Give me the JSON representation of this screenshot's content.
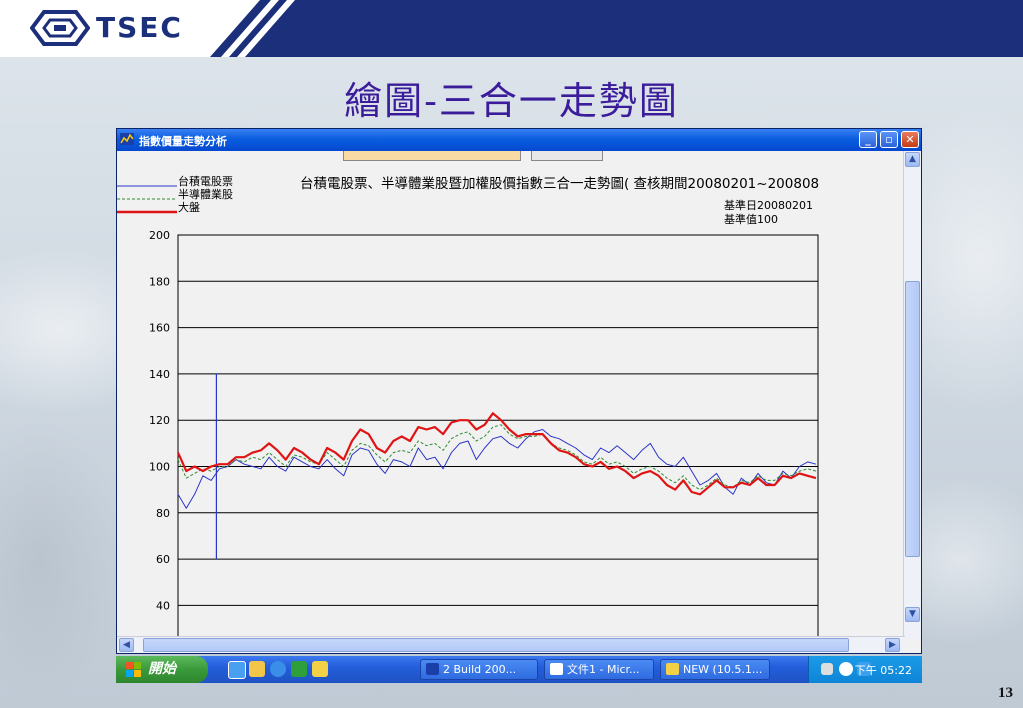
{
  "slide": {
    "logo_text": "TSEC",
    "title": "繪圖-三合一走勢圖",
    "page_number": "13"
  },
  "window": {
    "title": "指數價量走勢分析",
    "buttons": [
      "minimize",
      "restore",
      "close"
    ]
  },
  "chart_data": {
    "type": "line",
    "title": "台積電股票、半導體業股暨加權股價指數三合一走勢圖( 查核期間20080201~200808",
    "base_date_label": "基準日20080201",
    "base_value_label": "基準值100",
    "ylim": [
      30,
      200
    ],
    "yticks": [
      200,
      180,
      160,
      140,
      120,
      100,
      80,
      60,
      40
    ],
    "marker_line": {
      "x": 0.06,
      "y_from": 60,
      "y_to": 140
    },
    "series": [
      {
        "name": "台積電股票",
        "color": "#2a35c9",
        "values": [
          88,
          82,
          88,
          96,
          94,
          99,
          100,
          103,
          101,
          100,
          99,
          104,
          100,
          98,
          104,
          102,
          100,
          99,
          103,
          99,
          96,
          105,
          108,
          107,
          101,
          97,
          103,
          102,
          100,
          108,
          103,
          104,
          99,
          106,
          110,
          111,
          103,
          108,
          112,
          113,
          110,
          108,
          112,
          115,
          116,
          113,
          112,
          110,
          108,
          105,
          103,
          108,
          106,
          109,
          106,
          103,
          107,
          110,
          104,
          101,
          100,
          104,
          98,
          92,
          94,
          97,
          91,
          88,
          95,
          92,
          97,
          93,
          92,
          98,
          95,
          100,
          102,
          101
        ]
      },
      {
        "name": "半導體業股",
        "color": "#2e8b2e",
        "dashed": true,
        "values": [
          103,
          95,
          97,
          99,
          98,
          100,
          100,
          103,
          102,
          104,
          103,
          106,
          103,
          100,
          105,
          104,
          102,
          101,
          106,
          103,
          100,
          107,
          110,
          109,
          105,
          102,
          106,
          107,
          106,
          111,
          109,
          110,
          107,
          112,
          114,
          115,
          111,
          113,
          117,
          118,
          114,
          112,
          113,
          113,
          114,
          110,
          108,
          107,
          105,
          102,
          101,
          104,
          101,
          102,
          100,
          97,
          99,
          100,
          98,
          95,
          93,
          96,
          92,
          90,
          92,
          95,
          92,
          91,
          94,
          93,
          96,
          94,
          94,
          97,
          96,
          98,
          99,
          98
        ]
      },
      {
        "name": "大盤",
        "color": "#e01414",
        "thick": true,
        "values": [
          106,
          98,
          100,
          98,
          100,
          101,
          101,
          104,
          104,
          106,
          107,
          110,
          107,
          103,
          108,
          106,
          103,
          101,
          108,
          106,
          103,
          111,
          116,
          114,
          108,
          106,
          111,
          113,
          111,
          117,
          116,
          117,
          114,
          119,
          120,
          120,
          116,
          118,
          123,
          120,
          116,
          113,
          114,
          114,
          114,
          110,
          107,
          106,
          104,
          101,
          100,
          102,
          99,
          100,
          98,
          95,
          97,
          98,
          96,
          92,
          90,
          94,
          89,
          88,
          91,
          94,
          91,
          91,
          93,
          92,
          95,
          92,
          92,
          96,
          95,
          97,
          96,
          95
        ]
      }
    ]
  },
  "taskbar": {
    "start_label": "開始",
    "tasks": [
      "2 Build 200...",
      "文件1 - Micr...",
      "NEW (10.5.1..."
    ],
    "clock": "下午 05:22"
  }
}
